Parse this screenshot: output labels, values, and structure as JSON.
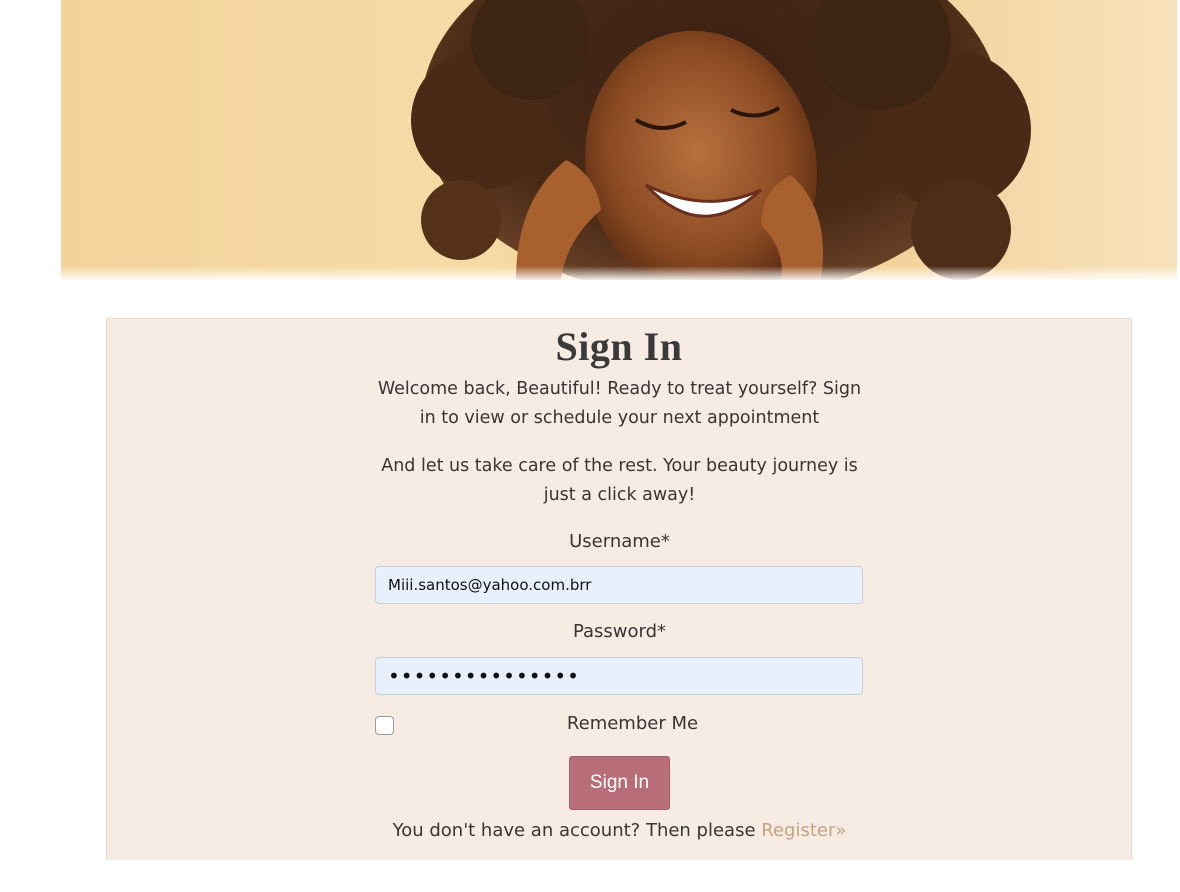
{
  "hero": {
    "image_description": "photo-of-smiling-woman-with-curly-hair"
  },
  "signin": {
    "title": "Sign In",
    "welcome_text": "Welcome back, Beautiful! Ready to treat yourself? Sign in to view or schedule your next appointment",
    "care_text": "And let us take care of the rest. Your beauty journey is just a click away!",
    "username_label": "Username*",
    "username_value": "Miii.santos@yahoo.com.brr",
    "password_label": "Password*",
    "password_value": "•••••••••••••••",
    "remember_label": "Remember Me",
    "remember_checked": false,
    "submit_label": "Sign In",
    "register_prompt": "You don't have an account? Then please ",
    "register_link": "Register»"
  },
  "colors": {
    "card_bg": "#f6ece3",
    "button_bg": "#b76e79",
    "link": "#c5a47e",
    "input_bg": "#e8f0fe"
  }
}
